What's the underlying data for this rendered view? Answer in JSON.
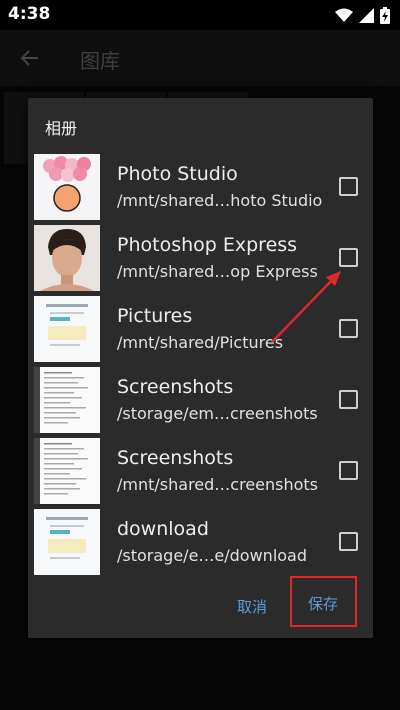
{
  "status_bar": {
    "time": "4:38",
    "icons": [
      "wifi-icon",
      "signal-icon",
      "battery-charging-icon"
    ]
  },
  "app_bar": {
    "title": "图库",
    "back_icon": "arrow-left-icon"
  },
  "dialog": {
    "title": "相册",
    "albums": [
      {
        "name": "Photo Studio",
        "path": "/mnt/shared…hoto Studio",
        "checked": false,
        "thumb": "hearts-image"
      },
      {
        "name": "Photoshop Express",
        "path": "/mnt/shared…op Express",
        "checked": false,
        "thumb": "portrait-image"
      },
      {
        "name": "Pictures",
        "path": "/mnt/shared/Pictures",
        "checked": false,
        "thumb": "document-screenshot"
      },
      {
        "name": "Screenshots",
        "path": "/storage/em…creenshots",
        "checked": false,
        "thumb": "text-screenshot"
      },
      {
        "name": "Screenshots",
        "path": "/mnt/shared…creenshots",
        "checked": false,
        "thumb": "text-screenshot"
      },
      {
        "name": "download",
        "path": "/storage/e…e/download",
        "checked": false,
        "thumb": "document-screenshot"
      }
    ],
    "cancel_label": "取消",
    "save_label": "保存"
  },
  "colors": {
    "accent": "#5b9bd5",
    "highlight": "#e3262b",
    "dialog_bg": "#2b2b2b"
  }
}
